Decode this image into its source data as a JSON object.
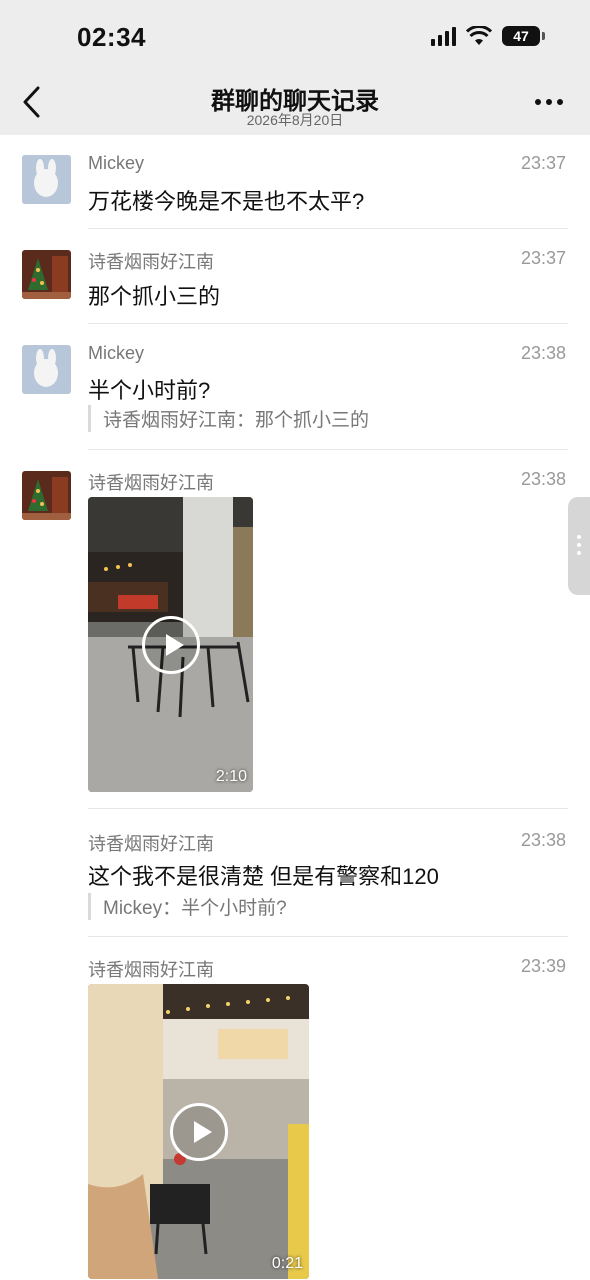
{
  "status": {
    "time": "02:34",
    "battery": "47"
  },
  "nav": {
    "title": "群聊的聊天记录",
    "date": "2026年8月20日"
  },
  "messages": [
    {
      "sender": "Mickey",
      "time": "23:37",
      "text": "万花楼今晚是不是也不太平?"
    },
    {
      "sender": "诗香烟雨好江南",
      "time": "23:37",
      "text": "那个抓小三的"
    },
    {
      "sender": "Mickey",
      "time": "23:38",
      "text": "半个小时前?",
      "quote": "诗香烟雨好江南：那个抓小三的"
    },
    {
      "sender": "诗香烟雨好江南",
      "time": "23:38",
      "video_duration": "2:10"
    },
    {
      "sender": "诗香烟雨好江南",
      "time": "23:38",
      "text": "这个我不是很清楚 但是有警察和120",
      "quote": "Mickey：半个小时前?"
    },
    {
      "sender": "诗香烟雨好江南",
      "time": "23:39",
      "video_duration": "0:21"
    }
  ],
  "icons": {
    "back": "chevron-left-icon",
    "more": "more-dots-icon",
    "signal": "cellular-signal-icon",
    "wifi": "wifi-icon",
    "battery": "battery-icon"
  }
}
